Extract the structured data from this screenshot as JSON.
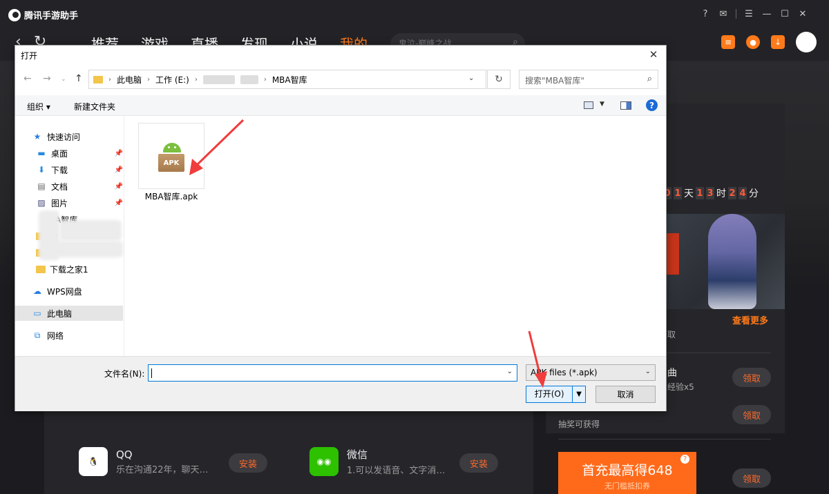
{
  "app": {
    "brand": "腾讯手游助手",
    "nav_tabs": [
      "推荐",
      "游戏",
      "直播",
      "发现",
      "小说",
      "我的"
    ],
    "active_tab": "我的",
    "search_placeholder": "鬼泣-巅峰之战",
    "countdown": {
      "digits": [
        "0",
        "1",
        "1",
        "3",
        "2",
        "4"
      ],
      "units": [
        "天",
        "时",
        "分"
      ]
    },
    "see_more": "查看更多",
    "right_panel": {
      "frag1": "取",
      "task1_title": "曲",
      "task1_desc": "经验x5",
      "task1_btn": "领取",
      "task2_desc": "抽奖可获得",
      "task2_btn": "领取",
      "promo_title": "首充最高得648",
      "promo_sub": "无门槛抵扣券",
      "task3_btn": "领取"
    },
    "apps": [
      {
        "name": "QQ",
        "desc": "乐在沟通22年，聊天…",
        "btn": "安装"
      },
      {
        "name": "微信",
        "desc": "1.可以发语音、文字消…",
        "btn": "安装"
      }
    ]
  },
  "dialog": {
    "title": "打开",
    "path": [
      "此电脑",
      "工作 (E:)",
      "MBA智库"
    ],
    "search_placeholder": "搜索\"MBA智库\"",
    "toolbar": {
      "organize": "组织 ▾",
      "new_folder": "新建文件夹"
    },
    "nav_pane": {
      "quick_access": "快速访问",
      "pinned": [
        "桌面",
        "下载",
        "文档",
        "图片"
      ],
      "partial_items": [
        "A智库",
        "沙",
        "打",
        "下载之家1"
      ],
      "wps": "WPS网盘",
      "this_pc": "此电脑",
      "network": "网络"
    },
    "file": {
      "name": "MBA智库.apk",
      "badge": "APK"
    },
    "filename_label": "文件名(N):",
    "filename_value": "",
    "filetype": "APK files (*.apk)",
    "open_btn": "打开(O)",
    "cancel_btn": "取消"
  },
  "colors": {
    "accent": "#ff7a1a",
    "annotation": "#f03c3c",
    "selection": "#0078d7"
  }
}
